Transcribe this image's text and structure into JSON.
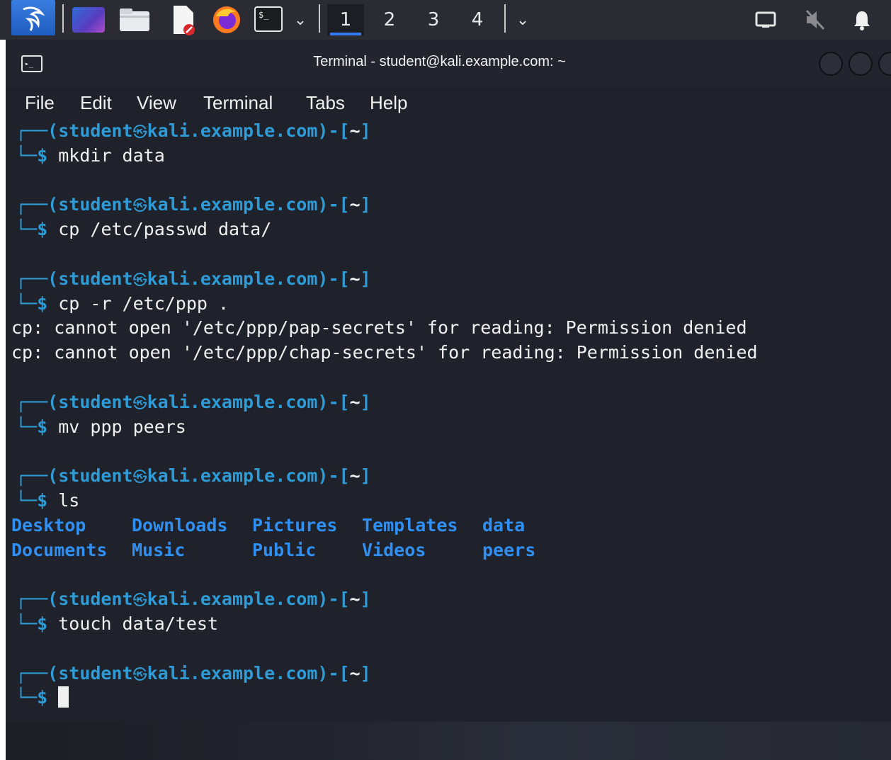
{
  "taskbar": {
    "workspaces": [
      "1",
      "2",
      "3",
      "4"
    ],
    "active_workspace": "1"
  },
  "window": {
    "title": "Terminal - student@kali.example.com: ~"
  },
  "menu": [
    "File",
    "Edit",
    "View",
    "Terminal",
    "Tabs",
    "Help"
  ],
  "prompt": {
    "open": "(",
    "user": "student",
    "host": "kali.example.com",
    "close": ")",
    "dash": "-",
    "dir_open": "[",
    "dir": "~",
    "dir_close": "]",
    "symbol": "$"
  },
  "commands": [
    {
      "cmd": "mkdir data",
      "output": []
    },
    {
      "cmd": "cp /etc/passwd data/",
      "output": []
    },
    {
      "cmd": "cp -r /etc/ppp .",
      "output": [
        "cp: cannot open '/etc/ppp/pap-secrets' for reading: Permission denied",
        "cp: cannot open '/etc/ppp/chap-secrets' for reading: Permission denied"
      ]
    },
    {
      "cmd": "mv ppp peers",
      "output": []
    },
    {
      "cmd": "ls",
      "ls_output": [
        [
          "Desktop",
          "Downloads",
          "Pictures",
          "Templates",
          "data"
        ],
        [
          "Documents",
          "Music",
          "Public",
          "Videos",
          "peers"
        ]
      ]
    },
    {
      "cmd": "touch data/test",
      "output": []
    },
    {
      "cmd": "",
      "output": [],
      "current": true
    }
  ],
  "colors": {
    "prompt": "#2f9bd6",
    "directory": "#2f8ff2",
    "background": "#1f222a"
  }
}
